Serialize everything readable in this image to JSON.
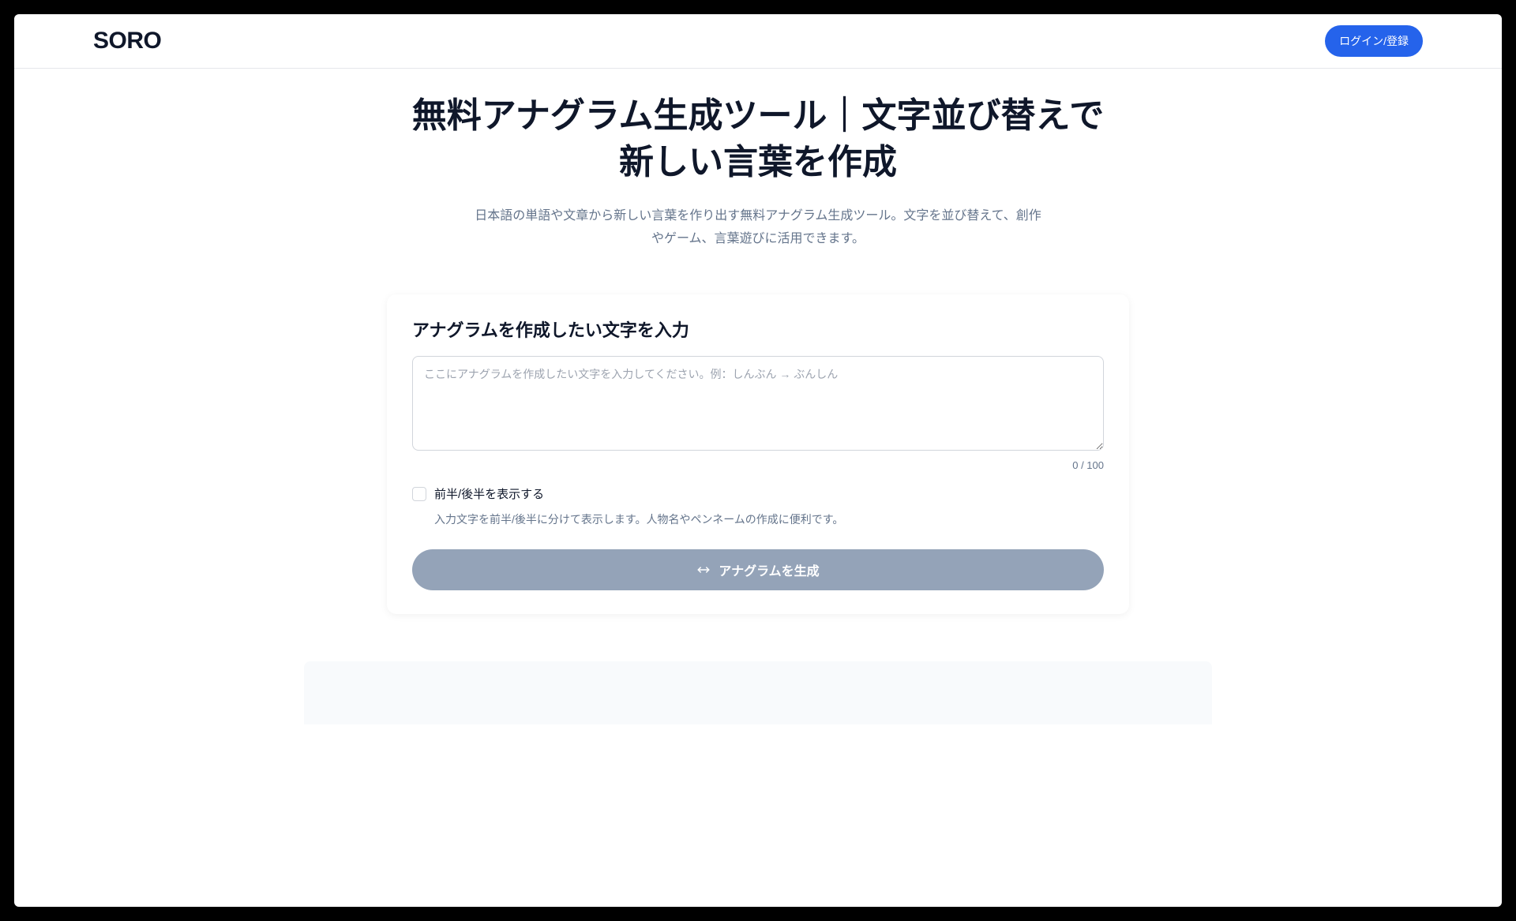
{
  "header": {
    "logo": "SORO",
    "login_label": "ログイン/登録"
  },
  "hero": {
    "title": "無料アナグラム生成ツール｜文字並び替えで新しい言葉を作成",
    "description": "日本語の単語や文章から新しい言葉を作り出す無料アナグラム生成ツール。文字を並び替えて、創作やゲーム、言葉遊びに活用できます。"
  },
  "form": {
    "heading": "アナグラムを作成したい文字を入力",
    "placeholder": "ここにアナグラムを作成したい文字を入力してください。例：しんぶん → ぶんしん",
    "counter": "0 / 100",
    "option_label": "前半/後半を表示する",
    "option_description": "入力文字を前半/後半に分けて表示します。人物名やペンネームの作成に便利です。",
    "generate_label": "アナグラムを生成"
  }
}
